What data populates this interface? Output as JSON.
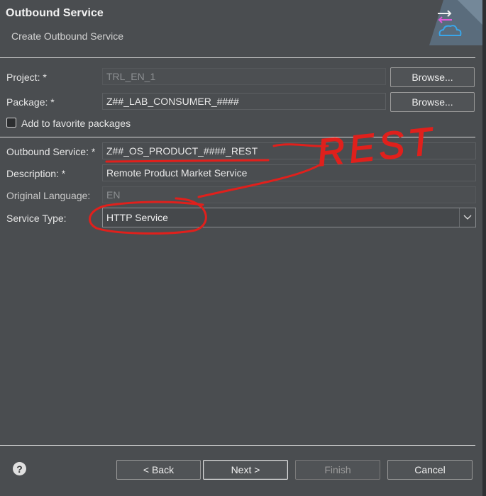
{
  "header": {
    "title": "Outbound Service",
    "subtitle": "Create Outbound Service"
  },
  "form": {
    "project_label": "Project: *",
    "project_value": "TRL_EN_1",
    "package_label": "Package: *",
    "package_value": "Z##_LAB_CONSUMER_####",
    "browse_label": "Browse...",
    "favorite_label": "Add to favorite packages",
    "favorite_checked": false,
    "outbound_label": "Outbound Service: *",
    "outbound_value": "Z##_OS_PRODUCT_####_REST",
    "description_label": "Description: *",
    "description_value": "Remote Product Market Service",
    "language_label": "Original Language:",
    "language_value": "EN",
    "service_type_label": "Service Type:",
    "service_type_value": "HTTP Service"
  },
  "footer": {
    "back_label": "< Back",
    "next_label": "Next >",
    "finish_label": "Finish",
    "cancel_label": "Cancel"
  },
  "annotation": {
    "text": "REST",
    "color": "#e0201c"
  }
}
